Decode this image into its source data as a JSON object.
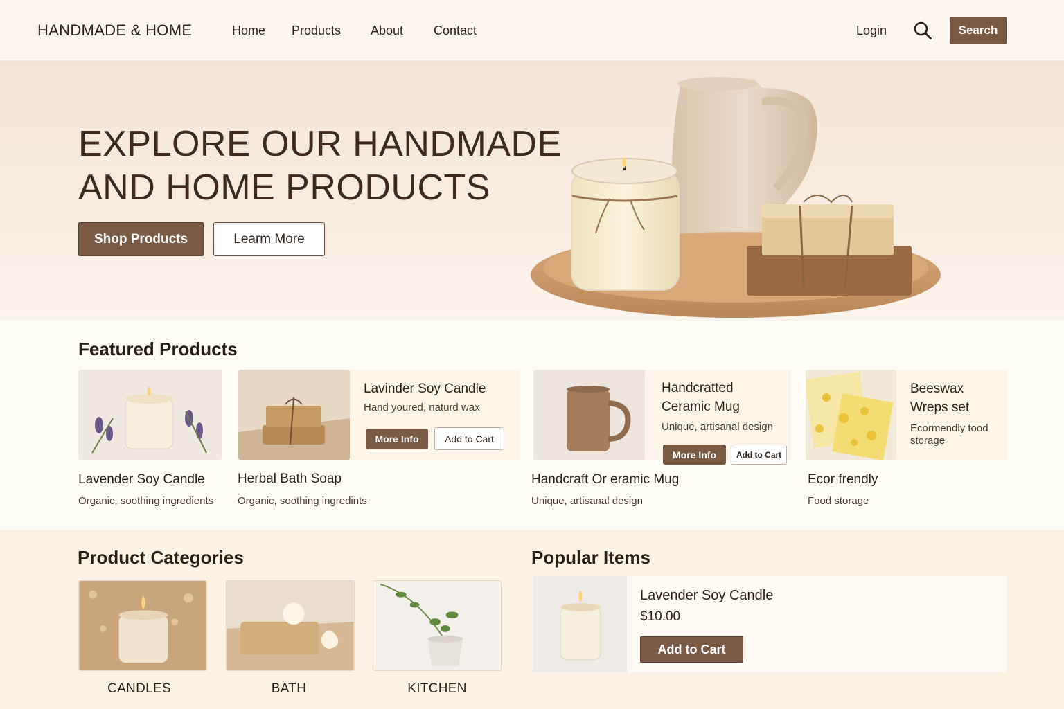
{
  "header": {
    "logo": "HANDMADE & HOME",
    "nav": [
      "Home",
      "Products",
      "About",
      "Contact"
    ],
    "login": "Login",
    "search_button": "Search",
    "search_icon": "search-icon"
  },
  "hero": {
    "title_line1": "EXPLORE OUR HANDMADE",
    "title_line2": "AND HOME PRODUCTS",
    "primary_button": "Shop Products",
    "secondary_button": "Learm More"
  },
  "featured": {
    "title": "Featured Products",
    "cards": [
      {
        "name": "Lavender Soy Candle",
        "desc": "Organic, soothing ingredients"
      },
      {
        "name": "Herbal Bath Soap",
        "desc": "Organic, soothing ingredints",
        "panel_title": "Lavinder Soy Candle",
        "panel_desc": "Hand youred, naturd wax",
        "more": "More Info",
        "cart": "Add to Cart"
      },
      {
        "name": "Handcraft Or eramic Mug",
        "desc": "Unique, artisanal design",
        "panel_title_1": "Handcratted",
        "panel_title_2": "Ceramic Mug",
        "panel_desc": "Unique, artisanal design",
        "more": "More Info",
        "cart": "Add to Cart"
      },
      {
        "name": "Ecor frendly",
        "desc": "Food storage",
        "panel_title_1": "Beeswax",
        "panel_title_2": "Wreps set",
        "panel_desc_1": "Ecormendly tood",
        "panel_desc_2": "storage"
      }
    ]
  },
  "categories": {
    "title": "Product Categories",
    "items": [
      "CANDLES",
      "BATH",
      "KITCHEN"
    ]
  },
  "popular": {
    "title": "Popular Items",
    "item": {
      "name": "Lavender Soy Candle",
      "price": "$10.00",
      "button": "Add to Cart"
    }
  },
  "colors": {
    "accent": "#7b5a44",
    "background": "#fdf8f0",
    "text": "#2a1f17"
  }
}
